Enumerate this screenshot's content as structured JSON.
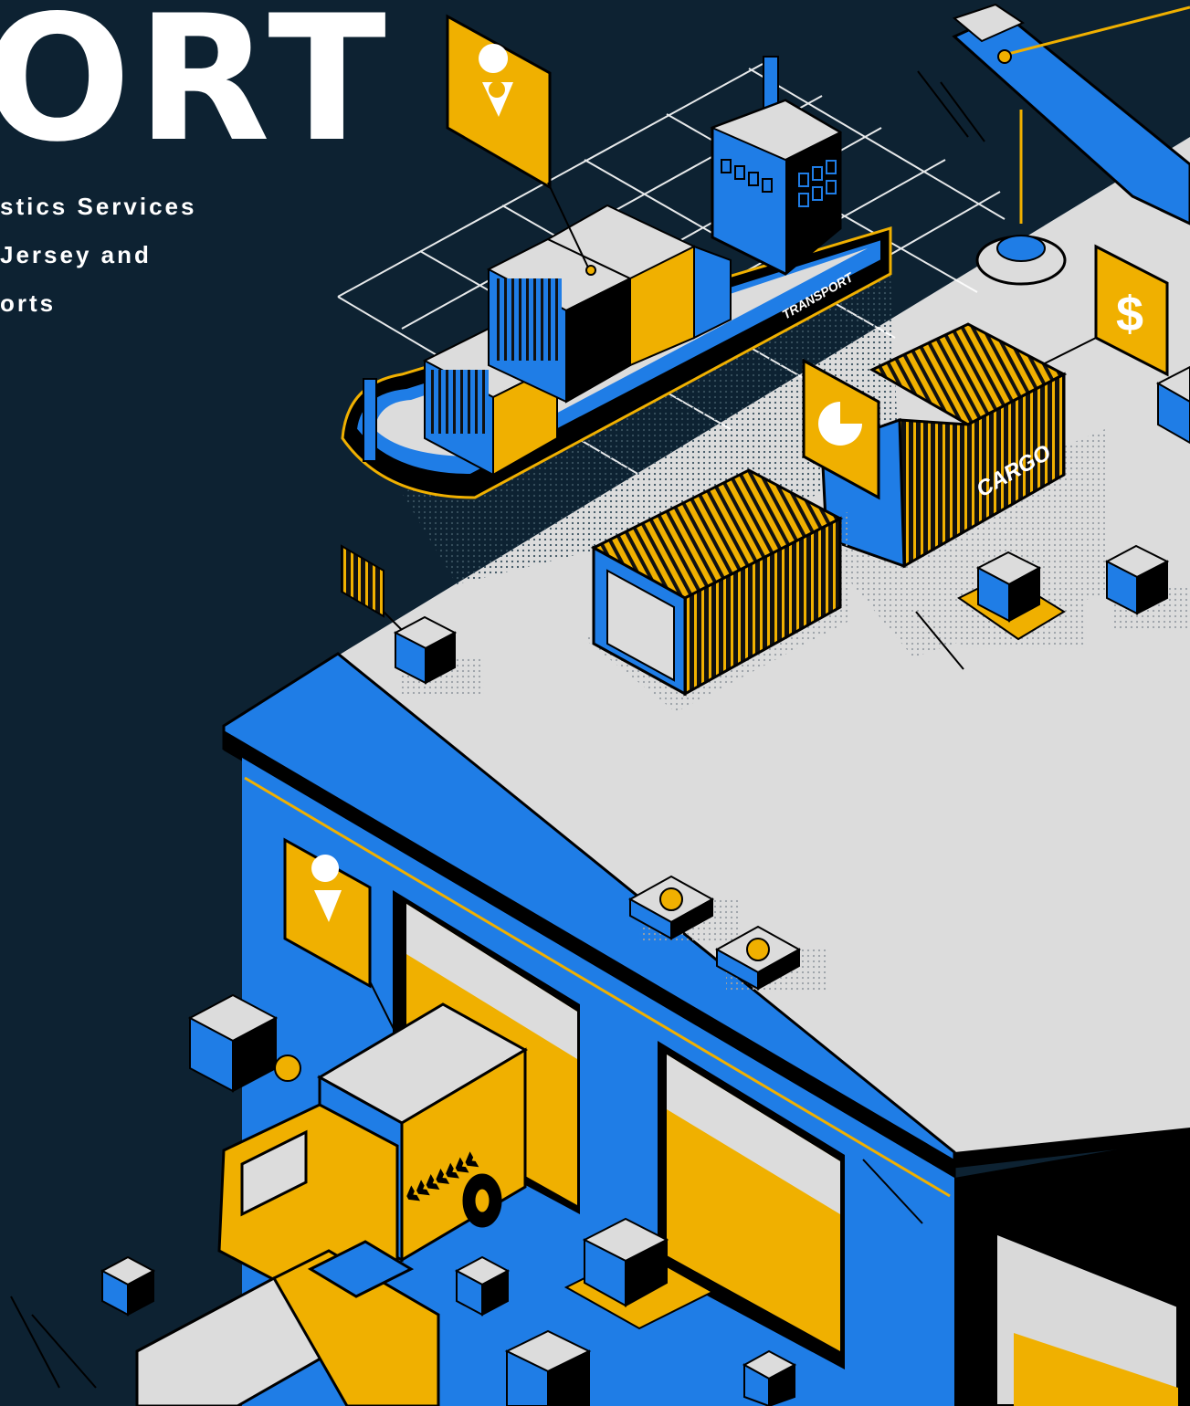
{
  "hero": {
    "title": "ORT",
    "subtitle_lines": [
      "stics Services",
      "Jersey and",
      "orts"
    ]
  },
  "illustration": {
    "ship_label": "TRANSPORT",
    "container_label": "CARGO",
    "price_sign_glyph": "$",
    "truck_marking": "‹‹‹‹‹‹‹",
    "icons": [
      "location-pin-icon",
      "dollar-icon",
      "pie-chart-icon",
      "location-pin-icon",
      "hatched-flag-icon"
    ]
  },
  "colors": {
    "background": "#0d2232",
    "accent_blue": "#1f7de6",
    "accent_yellow": "#f0b000",
    "floor": "#dcdcdc",
    "outline": "#000000",
    "text": "#ffffff"
  }
}
